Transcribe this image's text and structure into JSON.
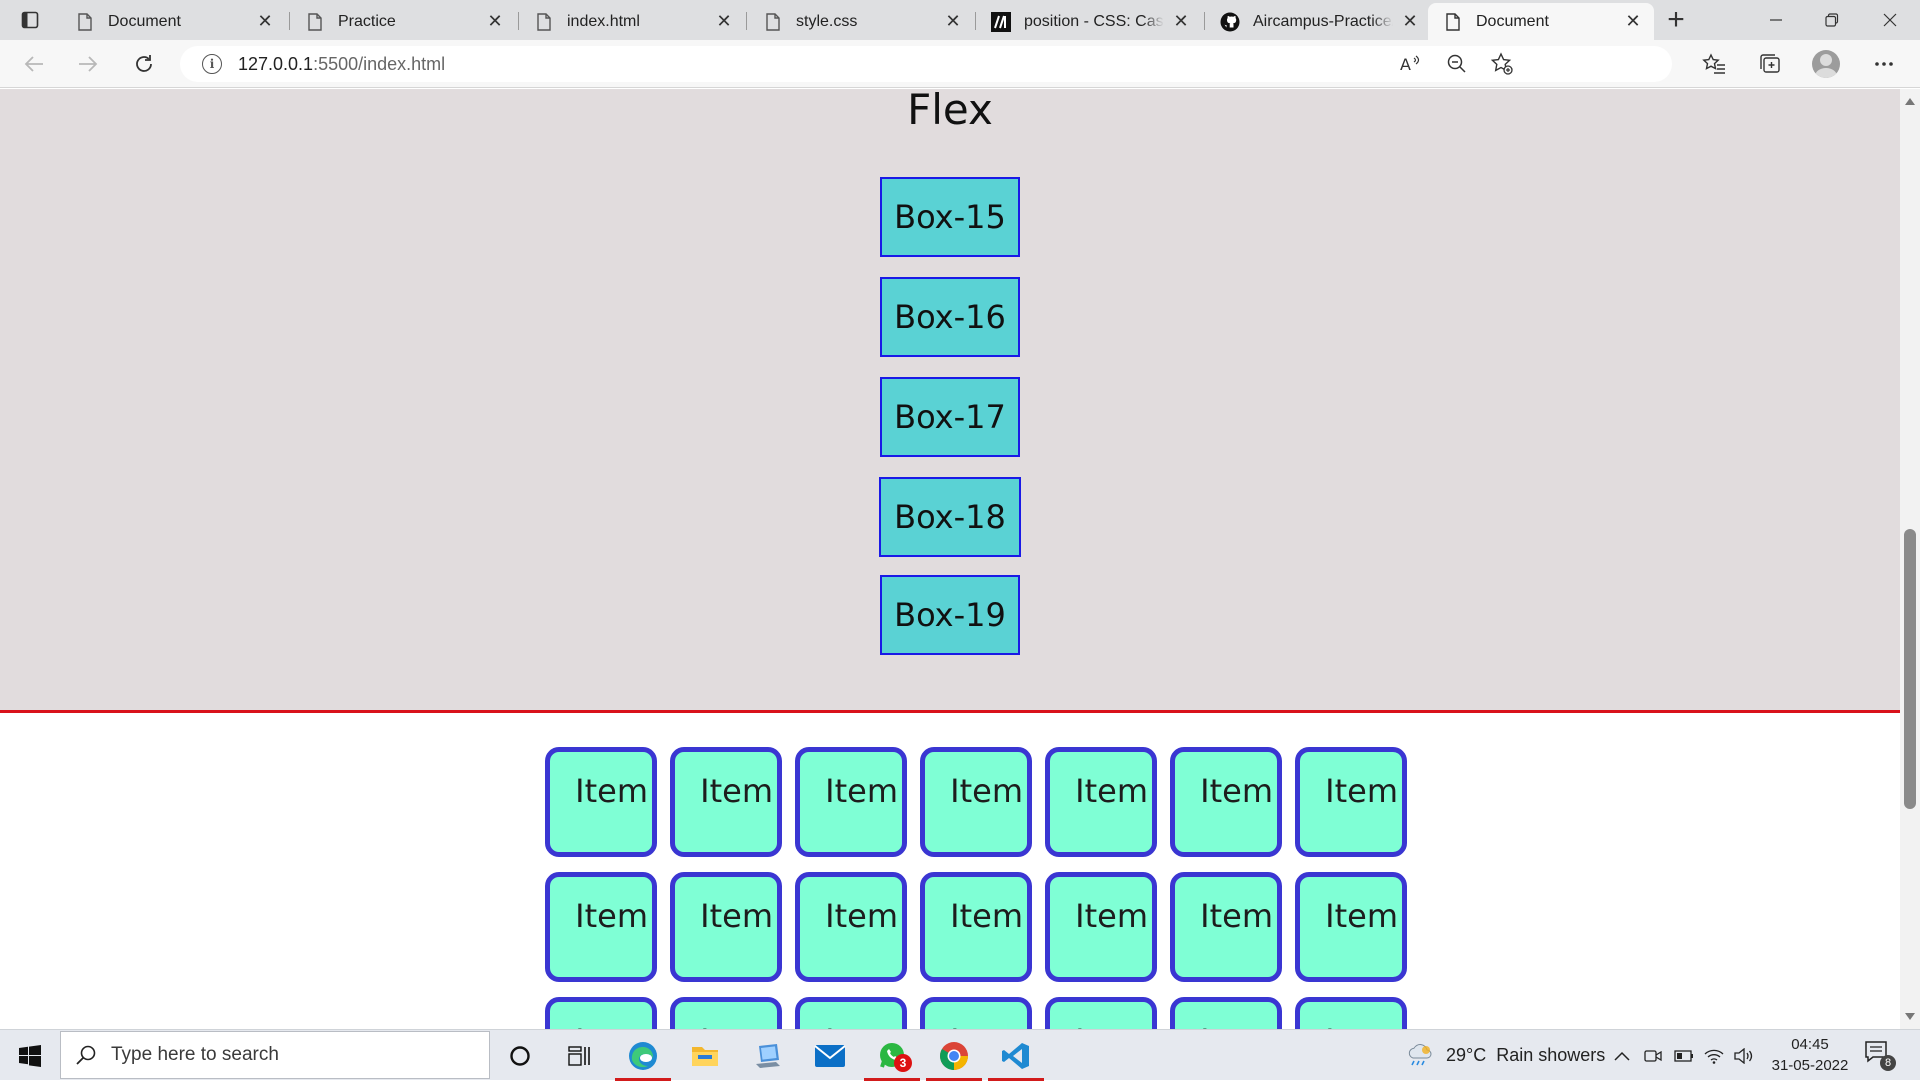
{
  "browser": {
    "tabs": [
      {
        "title": "Document",
        "icon": "page-icon",
        "active": false
      },
      {
        "title": "Practice",
        "icon": "page-icon",
        "active": false
      },
      {
        "title": "index.html",
        "icon": "page-icon",
        "active": false
      },
      {
        "title": "style.css",
        "icon": "page-icon",
        "active": false
      },
      {
        "title": "position - CSS: Cascading",
        "icon": "mdn-icon",
        "active": false
      },
      {
        "title": "Aircampus-Practice/style",
        "icon": "github-icon",
        "active": false
      },
      {
        "title": "Document",
        "icon": "page-icon",
        "active": true
      }
    ],
    "close_glyph": "✕",
    "new_tab_glyph": "+",
    "url_host": "127.0.0.1",
    "url_rest": ":5500/index.html"
  },
  "page": {
    "flex_title": "Flex",
    "boxes": [
      "Box-15",
      "Box-16",
      "Box-17",
      "Box-18",
      "Box-19"
    ],
    "item_label": "Item",
    "colors": {
      "section_bg": "#e1dcdd",
      "divider": "#d9121b",
      "box_fill": "#5ad2d4",
      "box_border": "#1a1ae6",
      "item_fill": "#7fffd5",
      "item_border": "#3a36d2"
    }
  },
  "taskbar": {
    "search_placeholder": "Type here to search",
    "apps": [
      "cortana-icon",
      "task-view-icon",
      "edge-icon",
      "file-explorer-icon",
      "my-computer-icon",
      "mail-icon",
      "whatsapp-icon",
      "chrome-icon",
      "vscode-icon"
    ],
    "whatsapp_badge": "3",
    "weather_temp": "29°C",
    "weather_desc": "Rain showers",
    "time": "04:45",
    "date": "31-05-2022",
    "notification_count": "8"
  }
}
